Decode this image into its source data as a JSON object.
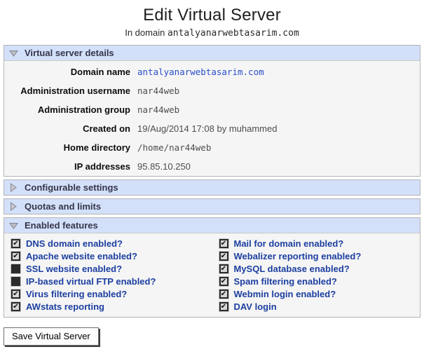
{
  "page": {
    "title": "Edit Virtual Server",
    "subtitle_prefix": "In domain",
    "domain": "antalyanarwebtasarim.com"
  },
  "sections": {
    "details": {
      "label": "Virtual server details",
      "expanded": true,
      "rows": [
        {
          "label": "Domain name",
          "value": "antalyanarwebtasarim.com",
          "style": "link-mono"
        },
        {
          "label": "Administration username",
          "value": "nar44web",
          "style": "mono"
        },
        {
          "label": "Administration group",
          "value": "nar44web",
          "style": "mono"
        },
        {
          "label": "Created on",
          "value": "19/Aug/2014 17:08 by muhammed",
          "style": "plain"
        },
        {
          "label": "Home directory",
          "value": "/home/nar44web",
          "style": "mono"
        },
        {
          "label": "IP addresses",
          "value": "95.85.10.250",
          "style": "plain"
        }
      ]
    },
    "configurable": {
      "label": "Configurable settings",
      "expanded": false
    },
    "quotas": {
      "label": "Quotas and limits",
      "expanded": false
    },
    "features": {
      "label": "Enabled features",
      "expanded": true,
      "left": [
        {
          "label": "DNS domain enabled?",
          "checked": true
        },
        {
          "label": "Apache website enabled?",
          "checked": true
        },
        {
          "label": "SSL website enabled?",
          "checked": false
        },
        {
          "label": "IP-based virtual FTP enabled?",
          "checked": false
        },
        {
          "label": "Virus filtering enabled?",
          "checked": true
        },
        {
          "label": "AWstats reporting",
          "checked": true
        }
      ],
      "right": [
        {
          "label": "Mail for domain enabled?",
          "checked": true
        },
        {
          "label": "Webalizer reporting enabled?",
          "checked": true
        },
        {
          "label": "MySQL database enabled?",
          "checked": true
        },
        {
          "label": "Spam filtering enabled?",
          "checked": true
        },
        {
          "label": "Webmin login enabled?",
          "checked": true
        },
        {
          "label": "DAV login",
          "checked": true
        }
      ]
    }
  },
  "footer": {
    "save_label": "Save Virtual Server"
  },
  "colors": {
    "section_header_bg": "#d3e0fa",
    "section_body_bg": "#f5f5f5",
    "feature_label_blue": "#1c3fa0",
    "domain_link_blue": "#2a4ec9"
  }
}
